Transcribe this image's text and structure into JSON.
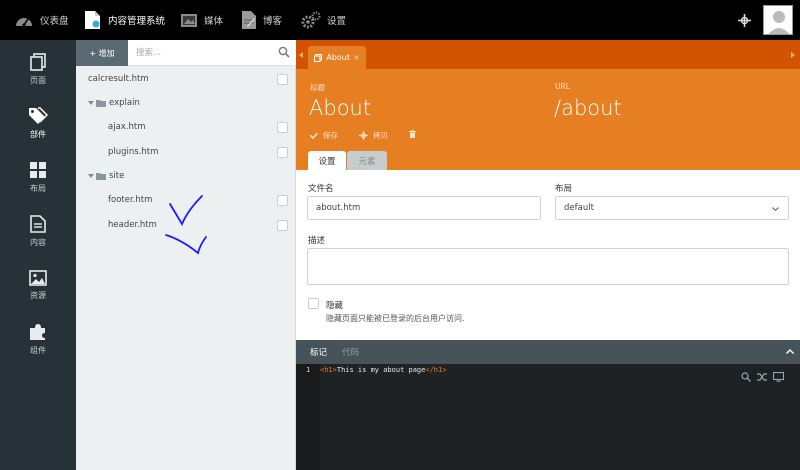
{
  "topbar": {
    "nav": [
      {
        "label": "仪表盘",
        "icon": "dashboard-icon"
      },
      {
        "label": "内容管理系统",
        "icon": "cms-icon",
        "active": true
      },
      {
        "label": "媒体",
        "icon": "media-icon"
      },
      {
        "label": "博客",
        "icon": "blog-icon"
      },
      {
        "label": "设置",
        "icon": "settings-icon"
      }
    ]
  },
  "sidebar": {
    "items": [
      {
        "label": "页面",
        "icon": "pages-icon"
      },
      {
        "label": "部件",
        "icon": "partials-icon",
        "active": true
      },
      {
        "label": "布局",
        "icon": "layouts-icon"
      },
      {
        "label": "内容",
        "icon": "content-icon"
      },
      {
        "label": "资源",
        "icon": "assets-icon"
      },
      {
        "label": "组件",
        "icon": "components-icon"
      }
    ]
  },
  "filepanel": {
    "add_label": "+ 增加",
    "search_placeholder": "搜索...",
    "items": [
      {
        "label": "calcresult.htm",
        "type": "file",
        "depth": 0
      },
      {
        "label": "explain",
        "type": "folder",
        "depth": 0
      },
      {
        "label": "ajax.htm",
        "type": "file",
        "depth": 1
      },
      {
        "label": "plugins.htm",
        "type": "file",
        "depth": 1
      },
      {
        "label": "site",
        "type": "folder",
        "depth": 0
      },
      {
        "label": "footer.htm",
        "type": "file",
        "depth": 1
      },
      {
        "label": "header.htm",
        "type": "file",
        "depth": 1
      }
    ]
  },
  "editor": {
    "doc_tab": "About",
    "title_label": "标题",
    "title_value": "About",
    "url_label": "URL",
    "url_value": "/about",
    "actions": {
      "save": "保存",
      "clone": "拷贝"
    },
    "subtabs": [
      "设置",
      "元素"
    ],
    "form": {
      "filename_label": "文件名",
      "filename_value": "about.htm",
      "layout_label": "布局",
      "layout_value": "default",
      "description_label": "描述",
      "hidden_label": "隐藏",
      "hidden_help": "隐藏页面只能被已登录的后台用户访问."
    },
    "code_tabs": [
      "标记",
      "代码"
    ],
    "code": {
      "line_number": "1",
      "open_tag": "<h1>",
      "text": "This is my about page",
      "close_tag": "</h1>"
    }
  },
  "colors": {
    "topbar": "#000000",
    "sidebar": "#263238",
    "accent": "#e67e22",
    "accent_dark": "#d35400",
    "editor_bg": "#1f2224",
    "annotation": "#1c1cff"
  }
}
